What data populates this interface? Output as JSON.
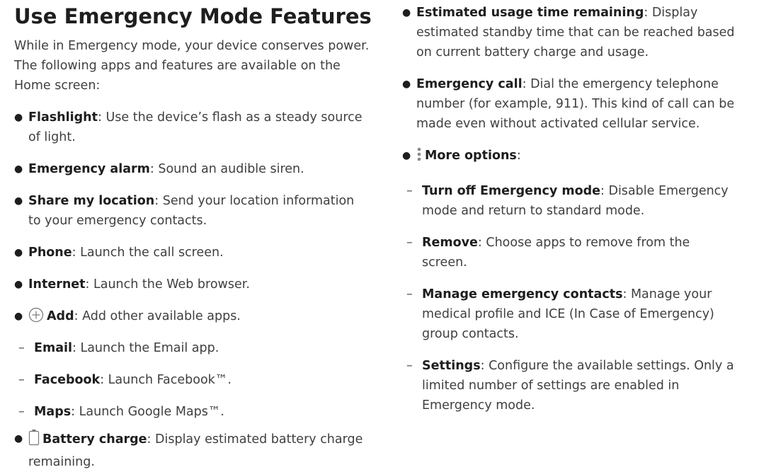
{
  "title": "Use Emergency Mode Features",
  "intro": "While in Emergency mode, your device conserves power. The following apps and features are available on the Home screen:",
  "left_items": [
    {
      "term": "Flashlight",
      "desc": ": Use the device’s flash as a steady source of light."
    },
    {
      "term": "Emergency alarm",
      "desc": ": Sound an audible siren."
    },
    {
      "term": "Share my location",
      "desc": ": Send your location information to your emergency contacts."
    },
    {
      "term": "Phone",
      "desc": ": Launch the call screen."
    },
    {
      "term": "Internet",
      "desc": ": Launch the Web browser."
    },
    {
      "term": "Add",
      "desc": ": Add other available apps.",
      "icon": "add-circle-icon"
    },
    {
      "term": "Email",
      "desc": ": Launch the Email app."
    },
    {
      "term": "Facebook",
      "desc": ": Launch Facebook™."
    },
    {
      "term": "Maps",
      "desc": ": Launch Google Maps™."
    },
    {
      "term": "Battery charge",
      "desc": ": Display estimated battery charge remaining.",
      "icon": "battery-icon"
    }
  ],
  "right_items": [
    {
      "term": "Estimated usage time remaining",
      "desc": ": Display estimated standby time that can be reached based on current battery charge and usage."
    },
    {
      "term": "Emergency call",
      "desc": ": Dial the emergency telephone number (for example, 911). This kind of call can be made even without activated cellular service."
    },
    {
      "term": "More options",
      "desc": ":",
      "icon": "more-options-icon"
    },
    {
      "term": "Turn off Emergency mode",
      "desc": ": Disable Emergency mode and return to standard mode."
    },
    {
      "term": "Remove",
      "desc": ": Choose apps to remove from the screen."
    },
    {
      "term": "Manage emergency contacts",
      "desc": ": Manage your medical profile and ICE (In Case of Emergency) group contacts."
    },
    {
      "term": "Settings",
      "desc": ": Configure the available settings. Only a limited number of settings are enabled in Emergency mode."
    }
  ],
  "bullet_char": "●",
  "dash_char": "–"
}
